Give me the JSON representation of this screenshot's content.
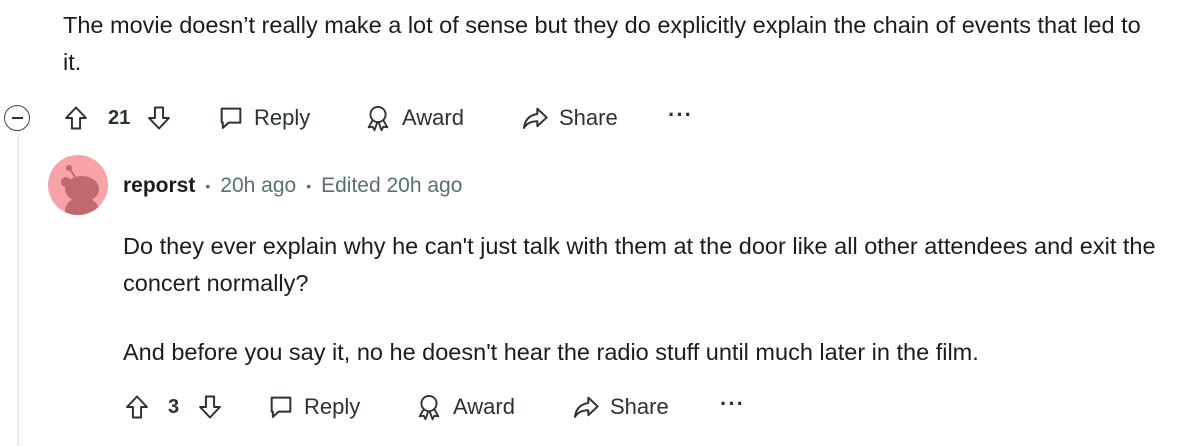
{
  "parent_comment": {
    "text": "The movie doesn’t really make a lot of sense but they do explicitly explain the chain of events that led to it.",
    "actions": {
      "score": "21",
      "reply_label": "Reply",
      "award_label": "Award",
      "share_label": "Share",
      "more_label": "···"
    }
  },
  "reply_comment": {
    "username": "reporst",
    "time": "20h ago",
    "edited": "Edited 20h ago",
    "separator": "•",
    "paragraphs": [
      "Do they ever explain why he can't just talk with them at the door like all other attendees and exit the concert normally?",
      "And before you say it, no he doesn't hear the radio stuff until much later in the film."
    ],
    "actions": {
      "score": "3",
      "reply_label": "Reply",
      "award_label": "Award",
      "share_label": "Share",
      "more_label": "···"
    }
  },
  "colors": {
    "text": "#1c1c1c",
    "meta": "#576f76",
    "icon": "#2a3236",
    "avatar_bg": "#f7a3a8",
    "avatar_fg": "#c0696f",
    "thread_line": "#e5ebee"
  },
  "icons": {
    "upvote": "upvote-arrow-icon",
    "downvote": "downvote-arrow-icon",
    "reply": "speech-bubble-icon",
    "award": "award-ribbon-icon",
    "share": "share-arrow-icon",
    "collapse": "minus-circle-icon"
  }
}
